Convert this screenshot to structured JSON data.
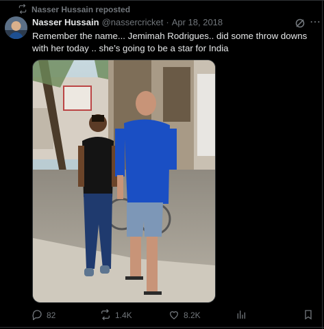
{
  "repost": {
    "label": "Nasser Hussain reposted"
  },
  "post": {
    "author_name": "Nasser Hussain",
    "handle": "@nassercricket",
    "separator": "·",
    "date": "Apr 18, 2018",
    "text": "Remember the name... Jemimah Rodrigues.. did some throw downs with her today .. she’s going to be a star for India"
  },
  "actions": {
    "replies": "82",
    "reposts": "1.4K",
    "likes": "8.2K"
  },
  "icons": [
    "repost-icon",
    "avatar",
    "grok-icon",
    "more-icon",
    "reply-icon",
    "repost-icon",
    "like-icon",
    "views-icon",
    "bookmark-icon",
    "share-icon"
  ],
  "colors": {
    "background": "#000000",
    "text": "#e7e9ea",
    "muted": "#71767b",
    "border": "#2f3336"
  }
}
